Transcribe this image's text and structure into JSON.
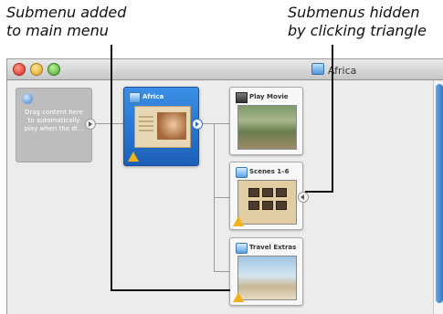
{
  "callouts": {
    "left": [
      "Submenu added",
      "to main menu"
    ],
    "right": [
      "Submenus hidden",
      "by clicking triangle"
    ]
  },
  "window": {
    "title": "Africa",
    "title_icon": "dvd-menu-icon"
  },
  "drop_area": {
    "text": "Drag content here to automatically play when the di...",
    "icon": "disc-icon"
  },
  "menus": {
    "main": {
      "title": "Africa",
      "icon": "menu-icon",
      "has_warning": true
    },
    "items": [
      {
        "title": "Play Movie",
        "icon": "movie-icon",
        "has_warning": false
      },
      {
        "title": "Scenes 1–6",
        "icon": "menu-icon",
        "has_warning": true
      },
      {
        "title": "Travel Extras",
        "icon": "menu-icon",
        "has_warning": true
      }
    ]
  },
  "colors": {
    "accent": "#2a6fc0",
    "warning": "#f0b21a"
  }
}
